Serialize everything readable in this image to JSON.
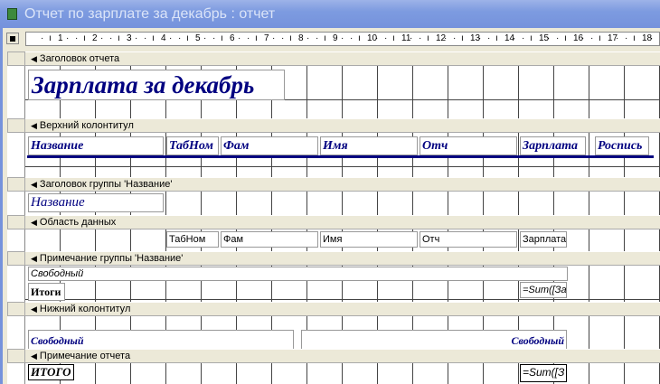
{
  "window": {
    "title": "Отчет по зарплате за декабрь : отчет"
  },
  "ruler": [
    "1",
    "2",
    "3",
    "4",
    "5",
    "6",
    "7",
    "8",
    "9",
    "10",
    "11",
    "12",
    "13",
    "14",
    "15",
    "16",
    "17",
    "18"
  ],
  "sections": {
    "report_header": "Заголовок отчета",
    "page_header": "Верхний колонтитул",
    "group_header": "Заголовок группы 'Название'",
    "detail": "Область данных",
    "group_footer": "Примечание группы 'Название'",
    "page_footer": "Нижний колонтитул",
    "report_footer": "Примечание отчета"
  },
  "report_title": "Зарплата за декабрь",
  "page_header_labels": [
    "Название",
    "ТабНом",
    "Фам",
    "Имя",
    "Отч",
    "Зарплата",
    "Роспись"
  ],
  "group_header_field": "Название",
  "detail_fields": [
    "ТабНом",
    "Фам",
    "Имя",
    "Отч",
    "Зарплата"
  ],
  "group_footer": {
    "free": "Свободный",
    "totals_label": "Итоги",
    "sum": "=Sum([За"
  },
  "page_footer": {
    "left": "Свободный",
    "right": "Свободный"
  },
  "report_footer": {
    "label": "ИТОГО",
    "sum": "=Sum([З"
  }
}
